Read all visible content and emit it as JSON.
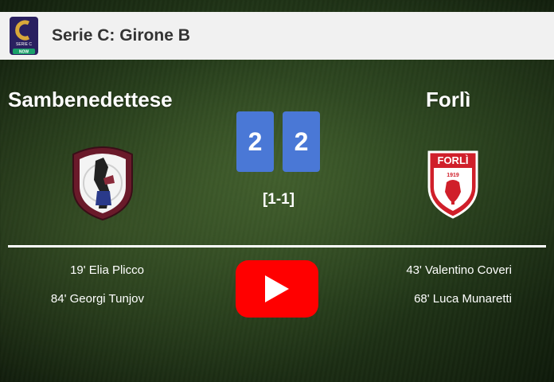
{
  "header": {
    "league_title": "Serie C: Girone B",
    "league_logo_text": "SERIE C",
    "league_logo_badge": "NOW"
  },
  "match": {
    "home_team": "Sambenedettese",
    "away_team": "Forlì",
    "home_score": "2",
    "away_score": "2",
    "halftime": "[1-1]",
    "away_crest_text": "FORLÌ",
    "away_crest_year": "1919"
  },
  "goals": {
    "home": [
      "19' Elia Plicco",
      "84' Georgi Tunjov"
    ],
    "away": [
      "43' Valentino Coveri",
      "68' Luca Munaretti"
    ]
  },
  "colors": {
    "score_box": "#4a78d6",
    "video_button": "#ff0000",
    "header_bg": "#f1f1f1"
  },
  "icons": {
    "video": "play-icon"
  }
}
